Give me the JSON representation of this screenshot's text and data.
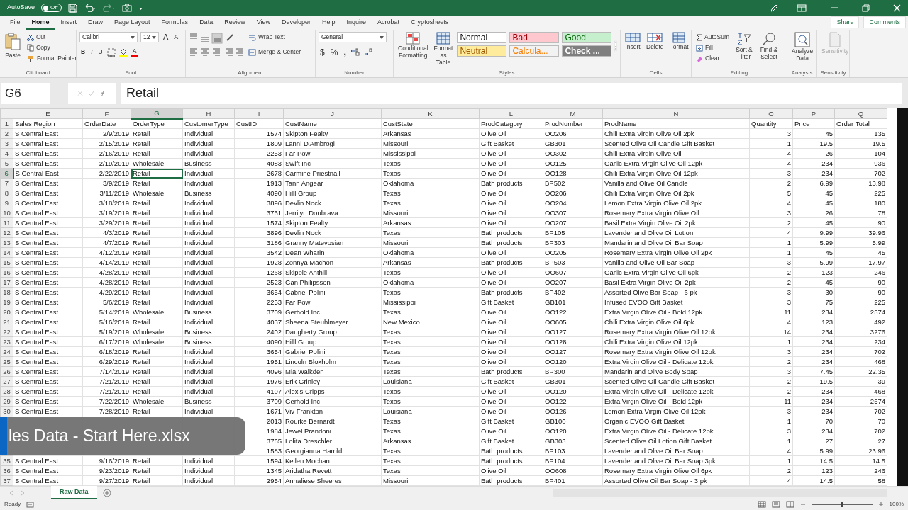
{
  "title_bar": {
    "autosave_label": "AutoSave",
    "autosave": {
      "on": false,
      "label": "Off"
    },
    "redo_disabled": true
  },
  "tabs": [
    {
      "label": "File",
      "selected": false
    },
    {
      "label": "Home",
      "selected": true
    },
    {
      "label": "Insert",
      "selected": false
    },
    {
      "label": "Draw",
      "selected": false
    },
    {
      "label": "Page Layout",
      "selected": false
    },
    {
      "label": "Formulas",
      "selected": false
    },
    {
      "label": "Data",
      "selected": false
    },
    {
      "label": "Review",
      "selected": false
    },
    {
      "label": "View",
      "selected": false
    },
    {
      "label": "Developer",
      "selected": false
    },
    {
      "label": "Help",
      "selected": false
    },
    {
      "label": "Inquire",
      "selected": false
    },
    {
      "label": "Acrobat",
      "selected": false
    },
    {
      "label": "Cryptosheets",
      "selected": false
    }
  ],
  "share": "Share",
  "comments": "Comments",
  "ribbon": {
    "clipboard": {
      "label": "Clipboard",
      "paste": "Paste",
      "cut": "Cut",
      "copy": "Copy",
      "format_painter": "Format Painter"
    },
    "font": {
      "label": "Font",
      "name": "Calibri",
      "size": "12",
      "grow": "A",
      "shrink": "A",
      "bold": "B",
      "italic": "I",
      "underline": "U",
      "font_color": "A"
    },
    "alignment": {
      "label": "Alignment",
      "wrap_text": "Wrap Text",
      "merge_center": "Merge & Center"
    },
    "number": {
      "label": "Number",
      "format": "General",
      "currency": "$",
      "percent": "%",
      "comma": ","
    },
    "styles": {
      "label": "Styles",
      "conditional": "Conditional Formatting",
      "format_table": "Format as Table",
      "gallery": [
        {
          "label": "Normal",
          "kind": "normal"
        },
        {
          "label": "Bad",
          "kind": "bad"
        },
        {
          "label": "Good",
          "kind": "good"
        },
        {
          "label": "Neutral",
          "kind": "neutral"
        },
        {
          "label": "Calcula...",
          "kind": "calculation"
        },
        {
          "label": "Check ...",
          "kind": "check"
        }
      ]
    },
    "cells": {
      "label": "Cells",
      "insert": "Insert",
      "delete": "Delete",
      "format": "Format"
    },
    "editing": {
      "label": "Editing",
      "autosum": "AutoSum",
      "fill": "Fill",
      "clear": "Clear",
      "sort_filter": "Sort & Filter",
      "find_select": "Find & Select"
    },
    "analysis": {
      "label": "Analysis",
      "analyze_data": "Analyze Data"
    },
    "sensitivity": {
      "label": "Sensitivity",
      "button": {
        "label": "Sensitivity",
        "disabled": true
      }
    }
  },
  "formula_bar": {
    "name_box": "G6",
    "formula": "Retail"
  },
  "sheet": {
    "columns": [
      {
        "label": "E",
        "selected": false
      },
      {
        "label": "F",
        "selected": false
      },
      {
        "label": "G",
        "selected": true
      },
      {
        "label": "H",
        "selected": false
      },
      {
        "label": "I",
        "selected": false
      },
      {
        "label": "J",
        "selected": false
      },
      {
        "label": "K",
        "selected": false
      },
      {
        "label": "L",
        "selected": false
      },
      {
        "label": "M",
        "selected": false
      },
      {
        "label": "N",
        "selected": false
      },
      {
        "label": "O",
        "selected": false
      },
      {
        "label": "P",
        "selected": false
      },
      {
        "label": "Q",
        "selected": false
      }
    ],
    "rows": [
      {
        "num": "1",
        "selected": false,
        "cells": [
          "Sales Region",
          "OrderDate",
          "OrderType",
          "CustomerType",
          "CustID",
          "CustName",
          "CustState",
          "ProdCategory",
          "ProdNumber",
          "ProdName",
          "Quantity",
          "Price",
          "Order Total"
        ]
      },
      {
        "num": "2",
        "selected": false,
        "cells": [
          "S Central East",
          "2/9/2019",
          "Retail",
          "Individual",
          "1574",
          "Skipton Fealty",
          "Arkansas",
          "Olive Oil",
          "OO206",
          "Chili Extra Virgin Olive Oil 2pk",
          "3",
          "45",
          "135"
        ]
      },
      {
        "num": "3",
        "selected": false,
        "cells": [
          "S Central East",
          "2/15/2019",
          "Retail",
          "Individual",
          "1809",
          "Lanni D'Ambrogi",
          "Missouri",
          "Gift Basket",
          "GB301",
          "Scented Olive Oil Candle Gift Basket",
          "1",
          "19.5",
          "19.5"
        ]
      },
      {
        "num": "4",
        "selected": false,
        "cells": [
          "S Central East",
          "2/16/2019",
          "Retail",
          "Individual",
          "2253",
          "Far Pow",
          "Mississippi",
          "Olive Oil",
          "OO302",
          "Chili Extra Virgin Olive Oil",
          "4",
          "26",
          "104"
        ]
      },
      {
        "num": "5",
        "selected": false,
        "cells": [
          "S Central East",
          "2/19/2019",
          "Wholesale",
          "Business",
          "4083",
          "Swift Inc",
          "Texas",
          "Olive Oil",
          "OO125",
          "Garlic Extra Virgin Olive Oil 12pk",
          "4",
          "234",
          "936"
        ]
      },
      {
        "num": "6",
        "selected": true,
        "cells": [
          "S Central East",
          "2/22/2019",
          "Retail",
          "Individual",
          "2678",
          "Carmine Priestnall",
          "Texas",
          "Olive Oil",
          "OO128",
          "Chili Extra Virgin Olive Oil 12pk",
          "3",
          "234",
          "702"
        ]
      },
      {
        "num": "7",
        "selected": false,
        "cells": [
          "S Central East",
          "3/9/2019",
          "Retail",
          "Individual",
          "1913",
          "Tann Angear",
          "Oklahoma",
          "Bath products",
          "BP502",
          "Vanilla and Olive Oil Candle",
          "2",
          "6.99",
          "13.98"
        ]
      },
      {
        "num": "8",
        "selected": false,
        "cells": [
          "S Central East",
          "3/11/2019",
          "Wholesale",
          "Business",
          "4090",
          "Hilll Group",
          "Texas",
          "Olive Oil",
          "OO206",
          "Chili Extra Virgin Olive Oil 2pk",
          "5",
          "45",
          "225"
        ]
      },
      {
        "num": "9",
        "selected": false,
        "cells": [
          "S Central East",
          "3/18/2019",
          "Retail",
          "Individual",
          "3896",
          "Devlin Nock",
          "Texas",
          "Olive Oil",
          "OO204",
          "Lemon Extra Virgin Olive Oil 2pk",
          "4",
          "45",
          "180"
        ]
      },
      {
        "num": "10",
        "selected": false,
        "cells": [
          "S Central East",
          "3/19/2019",
          "Retail",
          "Individual",
          "3761",
          "Jerrilyn Doubrava",
          "Missouri",
          "Olive Oil",
          "OO307",
          "Rosemary Extra Virgin Olive Oil",
          "3",
          "26",
          "78"
        ]
      },
      {
        "num": "11",
        "selected": false,
        "cells": [
          "S Central East",
          "3/29/2019",
          "Retail",
          "Individual",
          "1574",
          "Skipton Fealty",
          "Arkansas",
          "Olive Oil",
          "OO207",
          "Basil Extra Virgin Olive Oil 2pk",
          "2",
          "45",
          "90"
        ]
      },
      {
        "num": "12",
        "selected": false,
        "cells": [
          "S Central East",
          "4/3/2019",
          "Retail",
          "Individual",
          "3896",
          "Devlin Nock",
          "Texas",
          "Bath products",
          "BP105",
          "Lavender and Olive Oil Lotion",
          "4",
          "9.99",
          "39.96"
        ]
      },
      {
        "num": "13",
        "selected": false,
        "cells": [
          "S Central East",
          "4/7/2019",
          "Retail",
          "Individual",
          "3186",
          "Granny Matevosian",
          "Missouri",
          "Bath products",
          "BP303",
          "Mandarin and Olive Oil Bar Soap",
          "1",
          "5.99",
          "5.99"
        ]
      },
      {
        "num": "14",
        "selected": false,
        "cells": [
          "S Central East",
          "4/12/2019",
          "Retail",
          "Individual",
          "3542",
          "Dean Wharin",
          "Oklahoma",
          "Olive Oil",
          "OO205",
          "Rosemary Extra Virgin Olive Oil 2pk",
          "1",
          "45",
          "45"
        ]
      },
      {
        "num": "15",
        "selected": false,
        "cells": [
          "S Central East",
          "4/14/2019",
          "Retail",
          "Individual",
          "1928",
          "Zonnya Machon",
          "Arkansas",
          "Bath products",
          "BP503",
          "Vanilla and Olive Oil Bar Soap",
          "3",
          "5.99",
          "17.97"
        ]
      },
      {
        "num": "16",
        "selected": false,
        "cells": [
          "S Central East",
          "4/28/2019",
          "Retail",
          "Individual",
          "1268",
          "Skipple Anthill",
          "Texas",
          "Olive Oil",
          "OO607",
          "Garlic Extra Virgin Olive Oil 6pk",
          "2",
          "123",
          "246"
        ]
      },
      {
        "num": "17",
        "selected": false,
        "cells": [
          "S Central East",
          "4/28/2019",
          "Retail",
          "Individual",
          "2523",
          "Gan Philipsson",
          "Oklahoma",
          "Olive Oil",
          "OO207",
          "Basil Extra Virgin Olive Oil 2pk",
          "2",
          "45",
          "90"
        ]
      },
      {
        "num": "18",
        "selected": false,
        "cells": [
          "S Central East",
          "4/29/2019",
          "Retail",
          "Individual",
          "3654",
          "Gabriel Polini",
          "Texas",
          "Bath products",
          "BP402",
          "Assorted Olive Bar Soap - 6 pk",
          "3",
          "30",
          "90"
        ]
      },
      {
        "num": "19",
        "selected": false,
        "cells": [
          "S Central East",
          "5/6/2019",
          "Retail",
          "Individual",
          "2253",
          "Far Pow",
          "Mississippi",
          "Gift Basket",
          "GB101",
          "Infused EVOO Gift Basket",
          "3",
          "75",
          "225"
        ]
      },
      {
        "num": "20",
        "selected": false,
        "cells": [
          "S Central East",
          "5/14/2019",
          "Wholesale",
          "Business",
          "3709",
          "Gerhold Inc",
          "Texas",
          "Olive Oil",
          "OO122",
          "Extra Virgin Olive Oil - Bold 12pk",
          "11",
          "234",
          "2574"
        ]
      },
      {
        "num": "21",
        "selected": false,
        "cells": [
          "S Central East",
          "5/16/2019",
          "Retail",
          "Individual",
          "4037",
          "Sheena Steuhlmeyer",
          "New Mexico",
          "Olive Oil",
          "OO605",
          "Chili Extra Virgin Olive Oil 6pk",
          "4",
          "123",
          "492"
        ]
      },
      {
        "num": "22",
        "selected": false,
        "cells": [
          "S Central East",
          "5/19/2019",
          "Wholesale",
          "Business",
          "2402",
          "Daugherty Group",
          "Texas",
          "Olive Oil",
          "OO127",
          "Rosemary Extra Virgin Olive Oil 12pk",
          "14",
          "234",
          "3276"
        ]
      },
      {
        "num": "23",
        "selected": false,
        "cells": [
          "S Central East",
          "6/17/2019",
          "Wholesale",
          "Business",
          "4090",
          "Hilll Group",
          "Texas",
          "Olive Oil",
          "OO128",
          "Chili Extra Virgin Olive Oil 12pk",
          "1",
          "234",
          "234"
        ]
      },
      {
        "num": "24",
        "selected": false,
        "cells": [
          "S Central East",
          "6/18/2019",
          "Retail",
          "Individual",
          "3654",
          "Gabriel Polini",
          "Texas",
          "Olive Oil",
          "OO127",
          "Rosemary Extra Virgin Olive Oil 12pk",
          "3",
          "234",
          "702"
        ]
      },
      {
        "num": "25",
        "selected": false,
        "cells": [
          "S Central East",
          "6/29/2019",
          "Retail",
          "Individual",
          "1951",
          "Lincoln Bloxholm",
          "Texas",
          "Olive Oil",
          "OO120",
          "Extra Virgin Olive Oil - Delicate 12pk",
          "2",
          "234",
          "468"
        ]
      },
      {
        "num": "26",
        "selected": false,
        "cells": [
          "S Central East",
          "7/14/2019",
          "Retail",
          "Individual",
          "4096",
          "Mia Walkden",
          "Texas",
          "Bath products",
          "BP300",
          "Mandarin and Olive Body Soap",
          "3",
          "7.45",
          "22.35"
        ]
      },
      {
        "num": "27",
        "selected": false,
        "cells": [
          "S Central East",
          "7/21/2019",
          "Retail",
          "Individual",
          "1976",
          "Erik Grinley",
          "Louisiana",
          "Gift Basket",
          "GB301",
          "Scented Olive Oil Candle Gift Basket",
          "2",
          "19.5",
          "39"
        ]
      },
      {
        "num": "28",
        "selected": false,
        "cells": [
          "S Central East",
          "7/21/2019",
          "Retail",
          "Individual",
          "4107",
          "Alexis Cripps",
          "Texas",
          "Olive Oil",
          "OO120",
          "Extra Virgin Olive Oil - Delicate 12pk",
          "2",
          "234",
          "468"
        ]
      },
      {
        "num": "29",
        "selected": false,
        "cells": [
          "S Central East",
          "7/22/2019",
          "Wholesale",
          "Business",
          "3709",
          "Gerhold Inc",
          "Texas",
          "Olive Oil",
          "OO122",
          "Extra Virgin Olive Oil - Bold 12pk",
          "11",
          "234",
          "2574"
        ]
      },
      {
        "num": "30",
        "selected": false,
        "cells": [
          "S Central East",
          "7/28/2019",
          "Retail",
          "Individual",
          "1671",
          "Viv Frankton",
          "Louisiana",
          "Olive Oil",
          "OO126",
          "Lemon Extra Virgin Olive Oil 12pk",
          "3",
          "234",
          "702"
        ]
      },
      {
        "num": null,
        "selected": false,
        "cells": [
          null,
          null,
          null,
          null,
          "2013",
          "Rourke Bernardt",
          "Texas",
          "Gift Basket",
          "GB100",
          "Organic EVOO Gift Basket",
          "1",
          "70",
          "70"
        ]
      },
      {
        "num": null,
        "selected": false,
        "cells": [
          null,
          null,
          null,
          null,
          "1984",
          "Jewel Prandoni",
          "Texas",
          "Olive Oil",
          "OO120",
          "Extra Virgin Olive Oil - Delicate 12pk",
          "3",
          "234",
          "702"
        ]
      },
      {
        "num": null,
        "selected": false,
        "cells": [
          null,
          null,
          null,
          null,
          "3765",
          "Lolita Dreschler",
          "Arkansas",
          "Gift Basket",
          "GB303",
          "Scented Olive Oil Lotion Gift Basket",
          "1",
          "27",
          "27"
        ]
      },
      {
        "num": null,
        "selected": false,
        "cells": [
          null,
          null,
          null,
          null,
          "1583",
          "Georgianna Harrild",
          "Texas",
          "Bath products",
          "BP103",
          "Lavender and Olive Oil Bar Soap",
          "4",
          "5.99",
          "23.96"
        ]
      },
      {
        "num": "35",
        "selected": false,
        "cells": [
          "S Central East",
          "9/16/2019",
          "Retail",
          "Individual",
          "1594",
          "Kellen Mochan",
          "Texas",
          "Bath products",
          "BP104",
          "Lavender and Olive Oil Bar Soap 3pk",
          "1",
          "14.5",
          "14.5"
        ]
      },
      {
        "num": "36",
        "selected": false,
        "cells": [
          "S Central East",
          "9/23/2019",
          "Retail",
          "Individual",
          "1345",
          "Aridatha Revett",
          "Texas",
          "Olive Oil",
          "OO608",
          "Rosemary Extra Virgin Olive Oil 6pk",
          "2",
          "123",
          "246"
        ]
      },
      {
        "num": "37",
        "selected": false,
        "cells": [
          "S Central East",
          "9/27/2019",
          "Retail",
          "Individual",
          "2954",
          "Annaliese Sheeres",
          "Missouri",
          "Bath products",
          "BP401",
          "Assorted Olive Oil Bar Soap - 3 pk",
          "4",
          "14.5",
          "58"
        ]
      }
    ]
  },
  "banner": {
    "text": "les Data - Start Here.xlsx"
  },
  "sheet_tabs": [
    {
      "label": "Raw Data",
      "selected": true
    }
  ],
  "status_bar": {
    "status": "Ready",
    "zoom_slider": {
      "level": 0.5
    },
    "zoom": "100%"
  }
}
